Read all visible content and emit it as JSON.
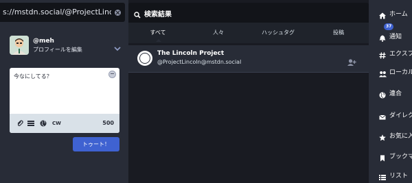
{
  "search": {
    "value": "s://mstdn.social/@ProjectLincoln"
  },
  "account": {
    "username": "@meh",
    "edit_profile": "プロフィールを編集"
  },
  "compose": {
    "placeholder": "今なにしてる？",
    "cw_label": "CW",
    "char_count": "500",
    "toot_label": "トゥート！"
  },
  "results": {
    "title": "検索結果",
    "tabs": [
      {
        "label": "すべて",
        "active": true
      },
      {
        "label": "人々",
        "active": false
      },
      {
        "label": "ハッシュタグ",
        "active": false
      },
      {
        "label": "投稿",
        "active": false
      }
    ],
    "items": [
      {
        "name": "The Lincoln Project",
        "handle": "@ProjectLincoln@mstdn.social"
      }
    ]
  },
  "nav": {
    "items": [
      {
        "label": "ホーム",
        "icon": "home-icon"
      },
      {
        "label": "通知",
        "icon": "bell-icon",
        "badge": "37"
      },
      {
        "label": "エクスプ",
        "icon": "hashtag-icon"
      },
      {
        "label": "ローカル",
        "icon": "users-icon"
      },
      {
        "label": "連合",
        "icon": "globe-icon"
      },
      {
        "label": "ダイレク",
        "icon": "envelope-icon"
      },
      {
        "label": "お気に入",
        "icon": "star-icon"
      },
      {
        "label": "ブックマ",
        "icon": "bookmark-icon"
      },
      {
        "label": "リスト",
        "icon": "list-icon"
      }
    ]
  },
  "colors": {
    "accent": "#3f62d1",
    "panel": "#282c37",
    "background": "#191b22",
    "dark_input": "#121419"
  }
}
